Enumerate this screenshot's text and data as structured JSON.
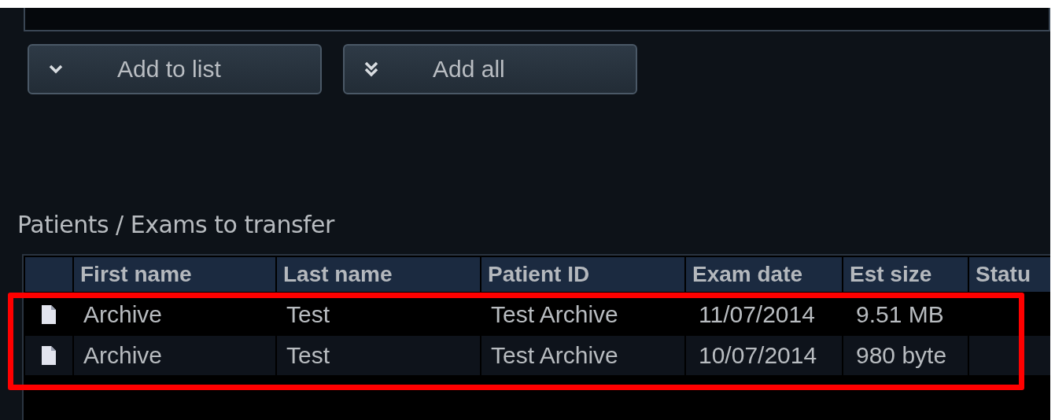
{
  "buttons": [
    {
      "label": "Add to list",
      "kind": "single"
    },
    {
      "label": "Add all",
      "kind": "double"
    }
  ],
  "transfer_list": {
    "title": "Patients / Exams to transfer",
    "columns": [
      "First name",
      "Last name",
      "Patient ID",
      "Exam date",
      "Est size",
      "Statu"
    ],
    "rows": [
      {
        "cells": [
          "Archive",
          "Test",
          "Test Archive",
          "11/07/2014",
          "9.51 MB"
        ]
      },
      {
        "cells": [
          "Archive",
          "Test",
          "Test Archive",
          "10/07/2014",
          "980 byte"
        ]
      }
    ]
  },
  "annotation": {
    "kind": "rectangle",
    "color": "#ff0000"
  }
}
